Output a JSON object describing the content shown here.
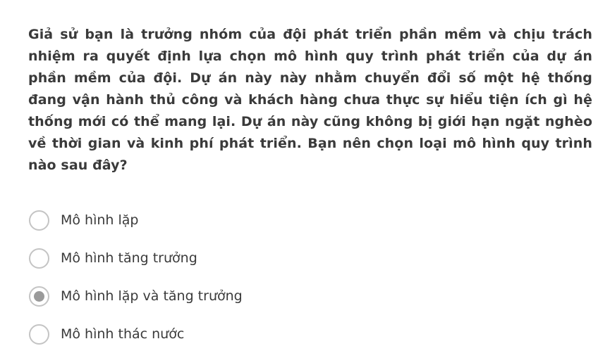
{
  "question": {
    "text": "Giả sử bạn là trưởng nhóm của đội phát triển phần mềm và chịu trách nhiệm ra quyết định lựa chọn mô hình quy trình phát triển của dự án phần mềm của đội. Dự án này này nhằm chuyển đổi số một hệ thống đang vận hành thủ công và khách hàng chưa thực sự hiểu tiện ích gì hệ thống mới có thể mang lại. Dự án này cũng không bị giới hạn ngặt nghèo về thời gian và kinh phí phát triển. Bạn nên chọn loại mô hình quy trình nào sau đây?"
  },
  "options": [
    {
      "label": "Mô hình lặp",
      "selected": false
    },
    {
      "label": "Mô hình tăng trưởng",
      "selected": false
    },
    {
      "label": "Mô hình lặp và tăng trưởng",
      "selected": true
    },
    {
      "label": "Mô hình thác nước",
      "selected": false
    }
  ],
  "colors": {
    "text": "#3a3a3a",
    "radio_border": "#c4c4c4",
    "radio_selected_dot": "#9a9a9a"
  }
}
